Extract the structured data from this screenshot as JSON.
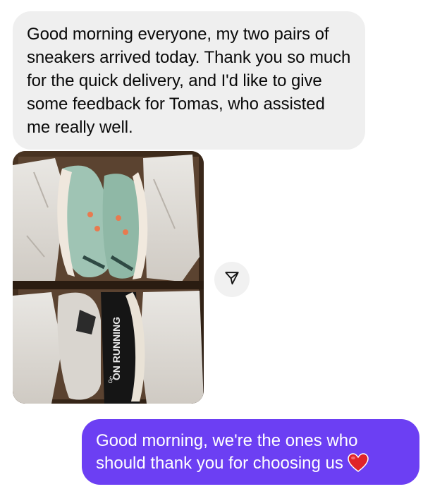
{
  "conversation": {
    "incoming_message": "Good morning everyone, my two pairs of sneakers arrived today. Thank you so much for the quick delivery, and I'd like to give some feedback for Tomas, who assisted me really well.",
    "photo": {
      "box_print": "ON RUNNING",
      "shoe_logo": "oc"
    },
    "share_icon": "send-icon",
    "outgoing_message": "Good morning, we're the ones who should thank you for choosing us",
    "outgoing_emoji": "heart-icon"
  },
  "colors": {
    "incoming_bubble": "#efefef",
    "outgoing_bubble": "#6c3ff3",
    "heart": "#e0242a"
  }
}
